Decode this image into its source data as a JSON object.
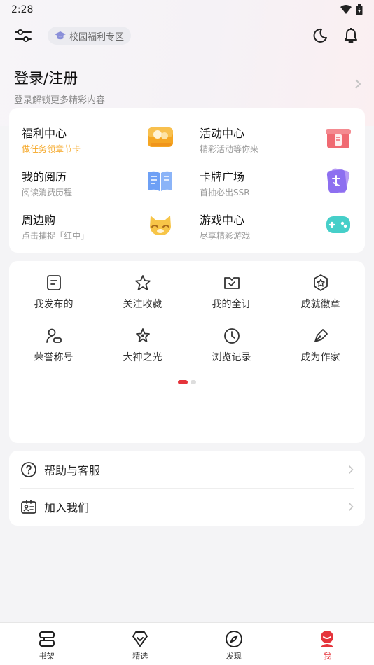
{
  "status_bar": {
    "time": "2:28"
  },
  "toolbar": {
    "campus_label": "校园福利专区"
  },
  "login": {
    "title": "登录/注册",
    "subtitle": "登录解锁更多精彩内容"
  },
  "features": [
    {
      "name": "福利中心",
      "sub": "做任务领章节卡",
      "icon": "coin-wallet-icon"
    },
    {
      "name": "活动中心",
      "sub": "精彩活动等你来",
      "icon": "gift-box-icon"
    },
    {
      "name": "我的阅历",
      "sub": "阅读消费历程",
      "icon": "open-book-icon"
    },
    {
      "name": "卡牌广场",
      "sub": "首抽必出SSR",
      "icon": "card-icon"
    },
    {
      "name": "周边购",
      "sub": "点击捕捉「红中」",
      "icon": "fox-mascot-icon"
    },
    {
      "name": "游戏中心",
      "sub": "尽享精彩游戏",
      "icon": "gamepad-icon"
    }
  ],
  "grid_items": [
    {
      "label": "我发布的",
      "icon": "document-icon"
    },
    {
      "label": "关注收藏",
      "icon": "star-icon"
    },
    {
      "label": "我的全订",
      "icon": "subscribe-check-icon"
    },
    {
      "label": "成就徽章",
      "icon": "badge-icon"
    },
    {
      "label": "荣誉称号",
      "icon": "user-title-icon"
    },
    {
      "label": "大神之光",
      "icon": "star-outline-icon"
    },
    {
      "label": "浏览记录",
      "icon": "clock-icon"
    },
    {
      "label": "成为作家",
      "icon": "pen-icon"
    }
  ],
  "list": [
    {
      "label": "帮助与客服",
      "icon": "help-circle-icon"
    },
    {
      "label": "加入我们",
      "icon": "id-card-icon"
    }
  ],
  "tabs": [
    {
      "label": "书架",
      "icon": "bookshelf-icon"
    },
    {
      "label": "精选",
      "icon": "diamond-icon"
    },
    {
      "label": "发现",
      "icon": "compass-icon"
    },
    {
      "label": "我",
      "icon": "profile-icon",
      "active": true
    }
  ],
  "colors": {
    "accent": "#e5343b",
    "welfare_sub": "#f5a623",
    "background": "#f4f4f6"
  }
}
